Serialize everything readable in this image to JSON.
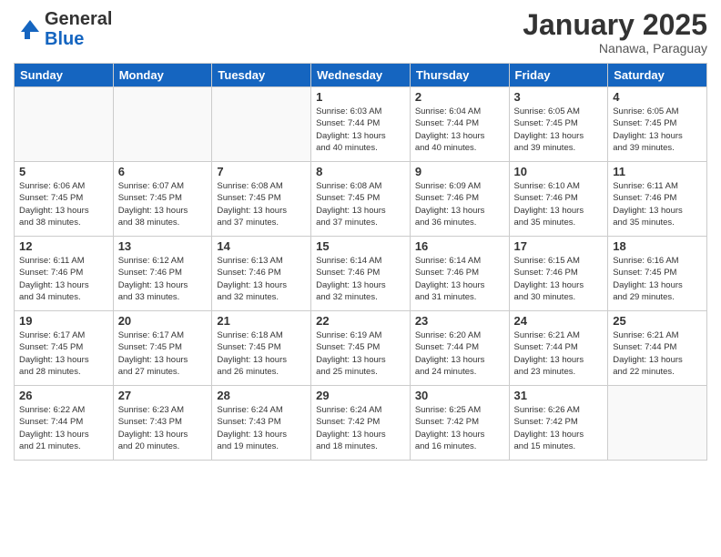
{
  "header": {
    "logo_general": "General",
    "logo_blue": "Blue",
    "month_title": "January 2025",
    "location": "Nanawa, Paraguay"
  },
  "days_of_week": [
    "Sunday",
    "Monday",
    "Tuesday",
    "Wednesday",
    "Thursday",
    "Friday",
    "Saturday"
  ],
  "weeks": [
    [
      {
        "day": "",
        "info": ""
      },
      {
        "day": "",
        "info": ""
      },
      {
        "day": "",
        "info": ""
      },
      {
        "day": "1",
        "info": "Sunrise: 6:03 AM\nSunset: 7:44 PM\nDaylight: 13 hours\nand 40 minutes."
      },
      {
        "day": "2",
        "info": "Sunrise: 6:04 AM\nSunset: 7:44 PM\nDaylight: 13 hours\nand 40 minutes."
      },
      {
        "day": "3",
        "info": "Sunrise: 6:05 AM\nSunset: 7:45 PM\nDaylight: 13 hours\nand 39 minutes."
      },
      {
        "day": "4",
        "info": "Sunrise: 6:05 AM\nSunset: 7:45 PM\nDaylight: 13 hours\nand 39 minutes."
      }
    ],
    [
      {
        "day": "5",
        "info": "Sunrise: 6:06 AM\nSunset: 7:45 PM\nDaylight: 13 hours\nand 38 minutes."
      },
      {
        "day": "6",
        "info": "Sunrise: 6:07 AM\nSunset: 7:45 PM\nDaylight: 13 hours\nand 38 minutes."
      },
      {
        "day": "7",
        "info": "Sunrise: 6:08 AM\nSunset: 7:45 PM\nDaylight: 13 hours\nand 37 minutes."
      },
      {
        "day": "8",
        "info": "Sunrise: 6:08 AM\nSunset: 7:45 PM\nDaylight: 13 hours\nand 37 minutes."
      },
      {
        "day": "9",
        "info": "Sunrise: 6:09 AM\nSunset: 7:46 PM\nDaylight: 13 hours\nand 36 minutes."
      },
      {
        "day": "10",
        "info": "Sunrise: 6:10 AM\nSunset: 7:46 PM\nDaylight: 13 hours\nand 35 minutes."
      },
      {
        "day": "11",
        "info": "Sunrise: 6:11 AM\nSunset: 7:46 PM\nDaylight: 13 hours\nand 35 minutes."
      }
    ],
    [
      {
        "day": "12",
        "info": "Sunrise: 6:11 AM\nSunset: 7:46 PM\nDaylight: 13 hours\nand 34 minutes."
      },
      {
        "day": "13",
        "info": "Sunrise: 6:12 AM\nSunset: 7:46 PM\nDaylight: 13 hours\nand 33 minutes."
      },
      {
        "day": "14",
        "info": "Sunrise: 6:13 AM\nSunset: 7:46 PM\nDaylight: 13 hours\nand 32 minutes."
      },
      {
        "day": "15",
        "info": "Sunrise: 6:14 AM\nSunset: 7:46 PM\nDaylight: 13 hours\nand 32 minutes."
      },
      {
        "day": "16",
        "info": "Sunrise: 6:14 AM\nSunset: 7:46 PM\nDaylight: 13 hours\nand 31 minutes."
      },
      {
        "day": "17",
        "info": "Sunrise: 6:15 AM\nSunset: 7:46 PM\nDaylight: 13 hours\nand 30 minutes."
      },
      {
        "day": "18",
        "info": "Sunrise: 6:16 AM\nSunset: 7:45 PM\nDaylight: 13 hours\nand 29 minutes."
      }
    ],
    [
      {
        "day": "19",
        "info": "Sunrise: 6:17 AM\nSunset: 7:45 PM\nDaylight: 13 hours\nand 28 minutes."
      },
      {
        "day": "20",
        "info": "Sunrise: 6:17 AM\nSunset: 7:45 PM\nDaylight: 13 hours\nand 27 minutes."
      },
      {
        "day": "21",
        "info": "Sunrise: 6:18 AM\nSunset: 7:45 PM\nDaylight: 13 hours\nand 26 minutes."
      },
      {
        "day": "22",
        "info": "Sunrise: 6:19 AM\nSunset: 7:45 PM\nDaylight: 13 hours\nand 25 minutes."
      },
      {
        "day": "23",
        "info": "Sunrise: 6:20 AM\nSunset: 7:44 PM\nDaylight: 13 hours\nand 24 minutes."
      },
      {
        "day": "24",
        "info": "Sunrise: 6:21 AM\nSunset: 7:44 PM\nDaylight: 13 hours\nand 23 minutes."
      },
      {
        "day": "25",
        "info": "Sunrise: 6:21 AM\nSunset: 7:44 PM\nDaylight: 13 hours\nand 22 minutes."
      }
    ],
    [
      {
        "day": "26",
        "info": "Sunrise: 6:22 AM\nSunset: 7:44 PM\nDaylight: 13 hours\nand 21 minutes."
      },
      {
        "day": "27",
        "info": "Sunrise: 6:23 AM\nSunset: 7:43 PM\nDaylight: 13 hours\nand 20 minutes."
      },
      {
        "day": "28",
        "info": "Sunrise: 6:24 AM\nSunset: 7:43 PM\nDaylight: 13 hours\nand 19 minutes."
      },
      {
        "day": "29",
        "info": "Sunrise: 6:24 AM\nSunset: 7:42 PM\nDaylight: 13 hours\nand 18 minutes."
      },
      {
        "day": "30",
        "info": "Sunrise: 6:25 AM\nSunset: 7:42 PM\nDaylight: 13 hours\nand 16 minutes."
      },
      {
        "day": "31",
        "info": "Sunrise: 6:26 AM\nSunset: 7:42 PM\nDaylight: 13 hours\nand 15 minutes."
      },
      {
        "day": "",
        "info": ""
      }
    ]
  ]
}
